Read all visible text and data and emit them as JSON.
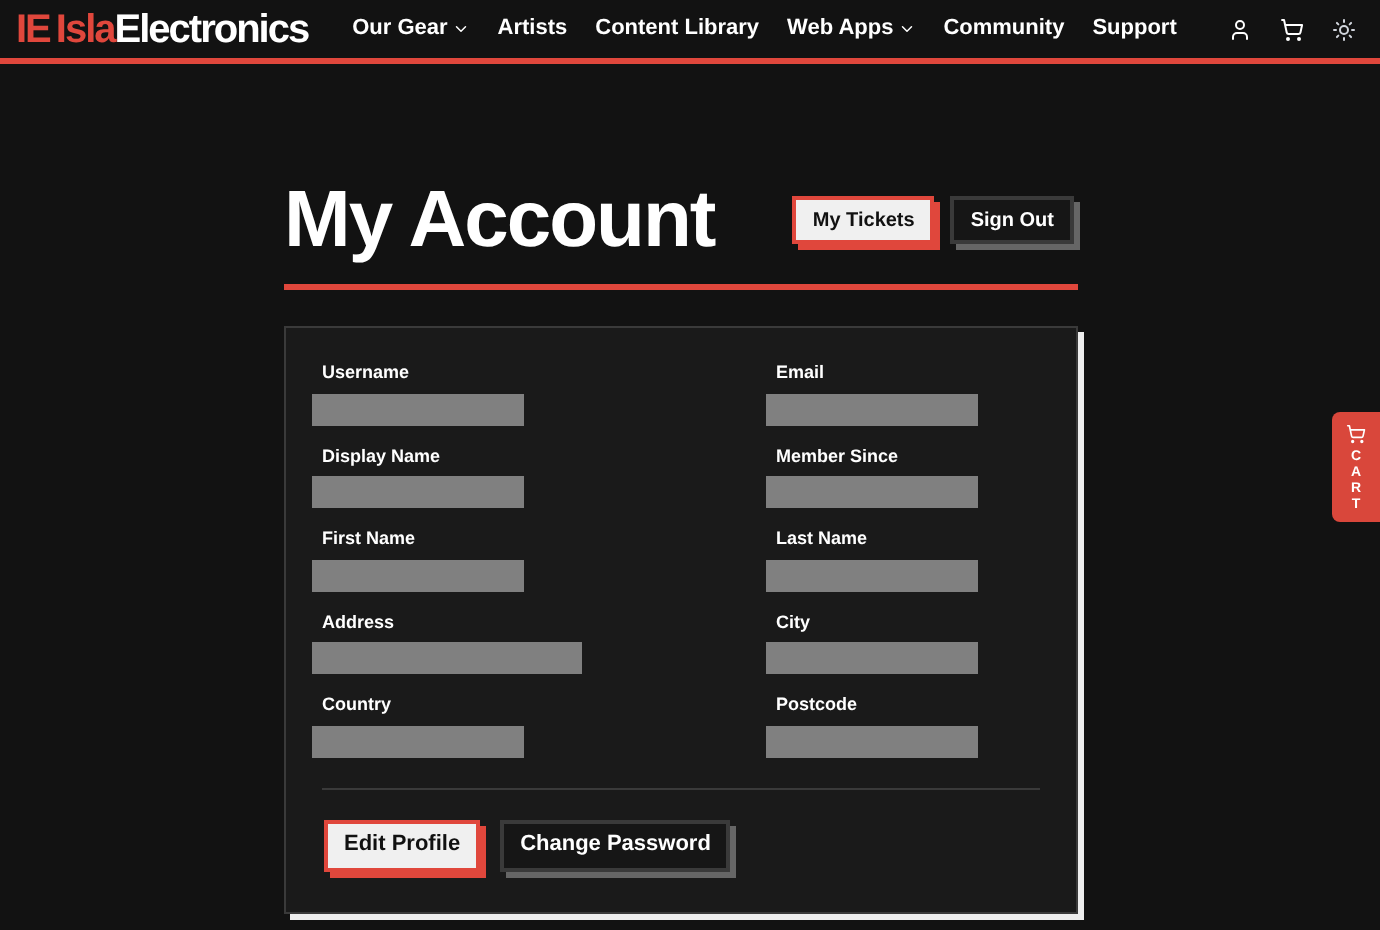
{
  "brand": {
    "mark": "IE",
    "first": "Isla",
    "second": "Electronics"
  },
  "nav": [
    {
      "label": "Our Gear",
      "dropdown": true
    },
    {
      "label": "Artists",
      "dropdown": false
    },
    {
      "label": "Content Library",
      "dropdown": false
    },
    {
      "label": "Web Apps",
      "dropdown": true
    },
    {
      "label": "Community",
      "dropdown": false
    },
    {
      "label": "Support",
      "dropdown": false
    }
  ],
  "page_title": "My Account",
  "header_buttons": [
    {
      "label": "My Tickets",
      "kind": "primary"
    },
    {
      "label": "Sign Out",
      "kind": "secondary"
    }
  ],
  "fields": [
    {
      "label": "Username",
      "wide": false
    },
    {
      "label": "Email",
      "wide": false
    },
    {
      "label": "Display Name",
      "wide": false
    },
    {
      "label": "Member Since",
      "wide": false
    },
    {
      "label": "First Name",
      "wide": false
    },
    {
      "label": "Last Name",
      "wide": false
    },
    {
      "label": "Address",
      "wide": true
    },
    {
      "label": "City",
      "wide": false
    },
    {
      "label": "Country",
      "wide": false
    },
    {
      "label": "Postcode",
      "wide": false
    }
  ],
  "form_buttons": [
    {
      "label": "Edit Profile",
      "kind": "primary"
    },
    {
      "label": "Change Password",
      "kind": "secondary"
    }
  ],
  "cart_tab": {
    "label": "CART"
  }
}
